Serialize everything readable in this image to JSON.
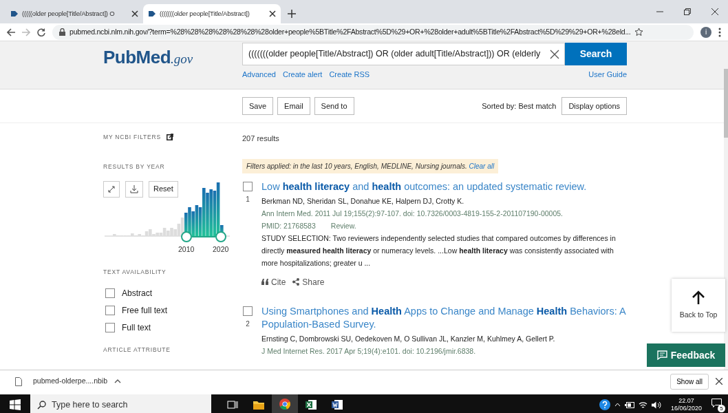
{
  "browser": {
    "tabs": [
      {
        "title": "(((((older people[Title/Abstract]) O",
        "selected": false
      },
      {
        "title": "(((((((older people[Title/Abstract])",
        "selected": true
      }
    ],
    "url": "pubmed.ncbi.nlm.nih.gov/?term=%28%28%28%28%28%28%28older+people%5BTitle%2FAbstract%5D%29+OR+%28older+adult%5BTitle%2FAbstract%5D%29%29+OR+%28eld...",
    "profile": "i"
  },
  "header": {
    "logo": {
      "main": "PubMed",
      "suffix": ".gov"
    },
    "search": {
      "value": "(((((((older people[Title/Abstract]) OR (older adult[Title/Abstract])) OR (elderly",
      "button": "Search"
    },
    "links": [
      "Advanced",
      "Create alert",
      "Create RSS"
    ],
    "user_guide": "User Guide"
  },
  "toolbar": {
    "buttons": [
      "Save",
      "Email",
      "Send to"
    ],
    "sort": "Sorted by: Best match",
    "display_options": "Display options"
  },
  "sidebar": {
    "my_ncbi": "MY NCBI FILTERS",
    "results_by_year": {
      "heading": "RESULTS BY YEAR",
      "reset": "Reset",
      "axis_labels": [
        "2010",
        "2020"
      ]
    },
    "text_availability": {
      "heading": "TEXT AVAILABILITY",
      "options": [
        {
          "label": "Abstract",
          "checked": false
        },
        {
          "label": "Free full text",
          "checked": false
        },
        {
          "label": "Full text",
          "checked": false
        }
      ]
    },
    "article_attribute": {
      "heading": "ARTICLE ATTRIBUTE"
    }
  },
  "results": {
    "count": "207 results",
    "filters": {
      "text": "Filters applied: in the last 10 years, English, MEDLINE, Nursing journals.",
      "link": "Clear all"
    },
    "articles": [
      {
        "number": "1",
        "checked": false,
        "title": "Low **health literacy** and **health** outcomes: an updated systematic review.",
        "authors": "Berkman ND, Sheridan SL, Donahue KE, Halpern DJ, Crotty K.",
        "citation": "Ann Intern Med. 2011 Jul 19;155(2):97-107. doi: 10.7326/0003-4819-155-2-201107190-00005.",
        "pmid": "PMID: 21768583",
        "type": "Review.",
        "snippet": "STUDY SELECTION: Two reviewers independently selected studies that compared outcomes by differences in directly **measured health literacy** or numeracy levels. ...Low **health literacy** was consistently associated with more hospitalizations; greater u ...",
        "actions": [
          "Cite",
          "Share"
        ]
      },
      {
        "number": "2",
        "checked": false,
        "title": "Using Smartphones and **Health** Apps to Change and Manage **Health** Behaviors: A Population-Based Survey.",
        "authors": "Ernsting C, Dombrowski SU, Oedekoven M, O Sullivan JL, Kanzler M, Kuhlmey A, Gellert P.",
        "citation": "J Med Internet Res. 2017 Apr 5;19(4):e101. doi: 10.2196/jmir.6838."
      }
    ]
  },
  "back_to_top": "Back to Top",
  "feedback": "Feedback",
  "download_bar": {
    "file": "pubmed-olderpe....nbib",
    "show_all": "Show all"
  },
  "taskbar": {
    "search_placeholder": "Type here to search",
    "apps": [
      {
        "kind": "taskview",
        "selected": false
      },
      {
        "kind": "explorer",
        "selected": false
      },
      {
        "kind": "chrome",
        "selected": true
      },
      {
        "kind": "excel",
        "selected": false
      },
      {
        "kind": "word",
        "selected": false
      }
    ],
    "time": "22.07",
    "date": "16/06/2020",
    "notifications": "5"
  }
}
